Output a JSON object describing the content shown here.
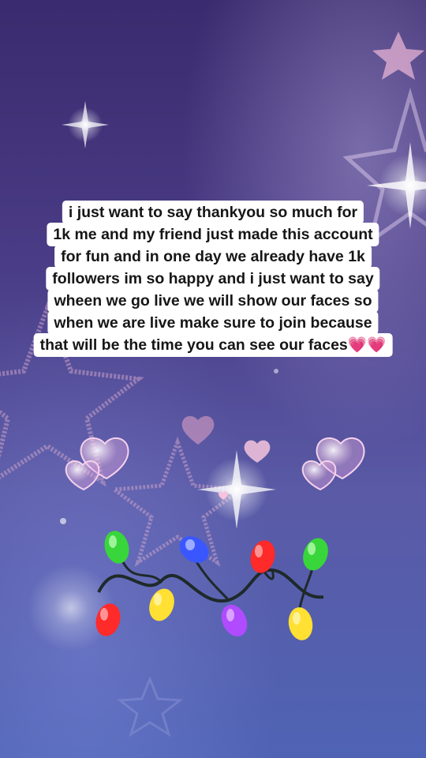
{
  "caption": {
    "lines": [
      "i just want to say thankyou so much for",
      "1k me and my friend just made this account",
      "for fun and in one day we already have 1k",
      "followers im so happy and i just want to say",
      "wheen we go live we will show our faces so",
      "when we are live make sure to join because",
      "that will be the time you can see our faces💗💗"
    ]
  },
  "colors": {
    "background_top": "#3a2a6e",
    "background_bottom": "#4f63b4",
    "caption_background": "#ffffff",
    "caption_text": "#161616",
    "light_red": "#ff2a2a",
    "light_green": "#38d63a",
    "light_blue": "#3a57ff",
    "light_yellow": "#ffe033",
    "light_purple": "#b14bff"
  },
  "decorations": {
    "icons": [
      "star-outline-icon",
      "heart-bubble-icon",
      "christmas-lights-icon",
      "sparkle-icon"
    ]
  }
}
